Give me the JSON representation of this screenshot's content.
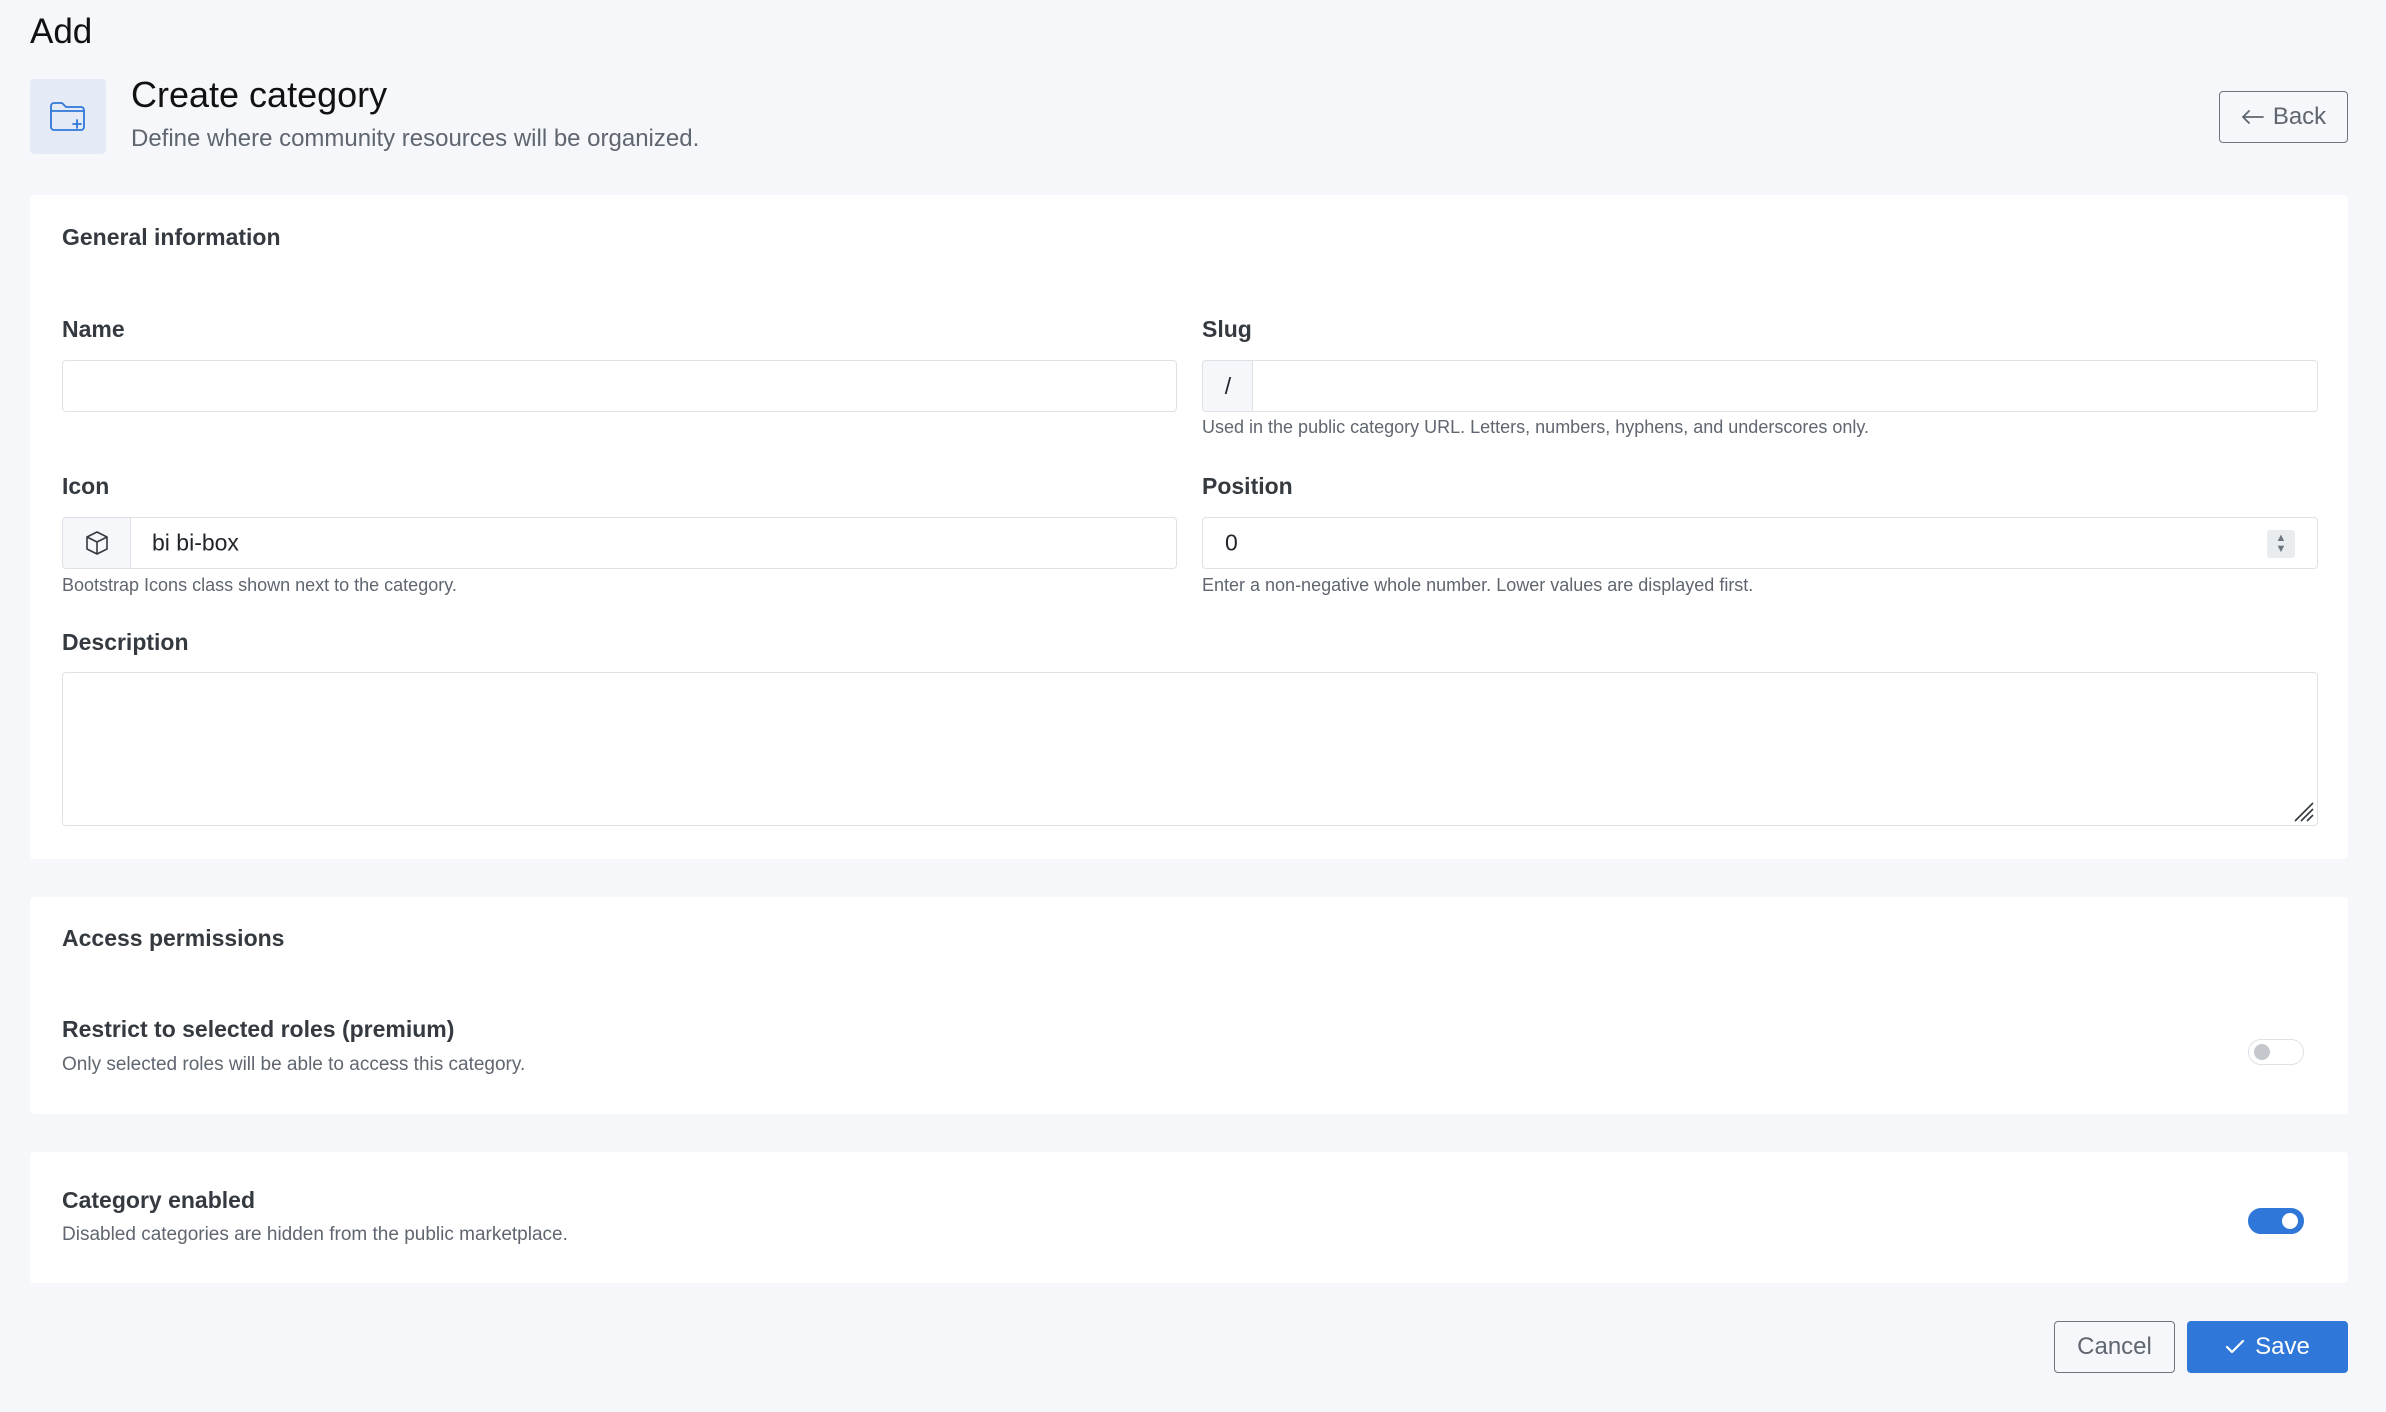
{
  "page": {
    "heading": "Add"
  },
  "header": {
    "icon": "folder-plus-icon",
    "title": "Create category",
    "subtitle": "Define where community resources will be organized.",
    "back_label": "Back"
  },
  "general": {
    "title": "General information",
    "name": {
      "label": "Name",
      "value": ""
    },
    "slug": {
      "label": "Slug",
      "prefix": "/",
      "value": "",
      "help": "Used in the public category URL. Letters, numbers, hyphens, and underscores only."
    },
    "icon": {
      "label": "Icon",
      "addon_icon": "box-icon",
      "value": "bi bi-box",
      "help": "Bootstrap Icons class shown next to the category."
    },
    "position": {
      "label": "Position",
      "value": "0",
      "help": "Enter a non-negative whole number. Lower values are displayed first."
    },
    "description": {
      "label": "Description",
      "value": ""
    }
  },
  "access": {
    "title": "Access permissions",
    "restrict": {
      "label": "Restrict to selected roles (premium)",
      "description": "Only selected roles will be able to access this category.",
      "enabled": false
    }
  },
  "status": {
    "label": "Category enabled",
    "description": "Disabled categories are hidden from the public marketplace.",
    "enabled": true
  },
  "actions": {
    "cancel_label": "Cancel",
    "save_label": "Save"
  },
  "colors": {
    "primary": "#2f77d8",
    "background": "#f5f7fb",
    "icon_box": "#e4ebf6"
  }
}
